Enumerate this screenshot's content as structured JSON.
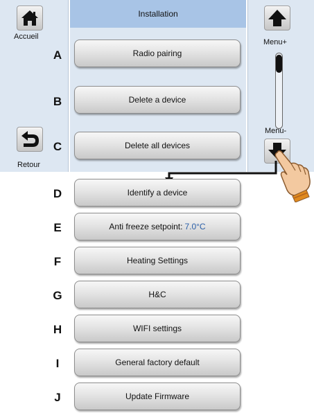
{
  "header": {
    "title": "Installation"
  },
  "nav": {
    "home_label": "Accueil",
    "back_label": "Retour",
    "menu_up_label": "Menu+",
    "menu_down_label": "Menu-"
  },
  "menu": [
    {
      "letter": "A",
      "label": "Radio pairing"
    },
    {
      "letter": "B",
      "label": "Delete a device"
    },
    {
      "letter": "C",
      "label": "Delete all devices"
    },
    {
      "letter": "D",
      "label": "Identify a device"
    },
    {
      "letter": "E",
      "label": "Anti freeze setpoint:",
      "value": "7.0°C"
    },
    {
      "letter": "F",
      "label": "Heating Settings"
    },
    {
      "letter": "G",
      "label": "H&C"
    },
    {
      "letter": "H",
      "label": "WIFI settings"
    },
    {
      "letter": "I",
      "label": "General factory default"
    },
    {
      "letter": "J",
      "label": "Update Firmware"
    }
  ],
  "colors": {
    "header_bg": "#a8c4e6",
    "panel_bg": "#dde7f2",
    "value_text": "#2a5fa8"
  }
}
